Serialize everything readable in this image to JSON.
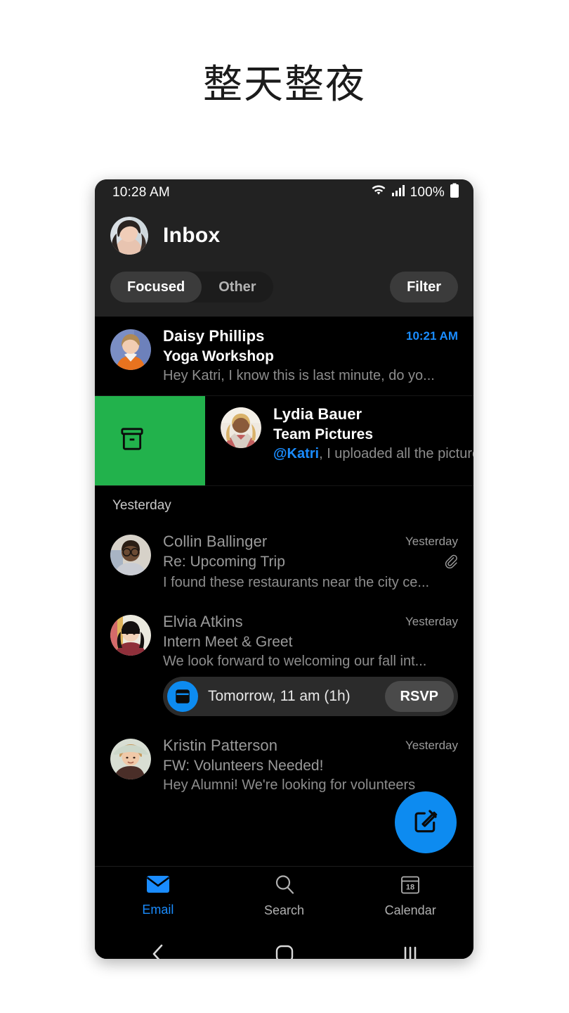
{
  "headline": "整天整夜",
  "statusbar": {
    "time": "10:28 AM",
    "battery_percent": "100%",
    "wifi_icon": "wifi-icon",
    "signal_icon": "signal-bars-icon",
    "battery_icon": "battery-full-icon"
  },
  "header": {
    "title": "Inbox",
    "avatar_icon": "user-avatar",
    "tabs": [
      {
        "label": "Focused",
        "active": true
      },
      {
        "label": "Other",
        "active": false
      }
    ],
    "filter_label": "Filter"
  },
  "swipe": {
    "action_label": "archive",
    "action_icon": "archive-box-icon",
    "action_color": "#22b24c"
  },
  "sections": [
    {
      "label": "Yesterday"
    }
  ],
  "emails": [
    {
      "sender": "Daisy Phillips",
      "subject": "Yoga Workshop",
      "preview": "Hey Katri, I know this is last minute, do yo...",
      "time": "10:21 AM",
      "unread": true,
      "attachment": false,
      "avatar_icon": "avatar-daisy-phillips"
    },
    {
      "sender": "Lydia Bauer",
      "subject": "Team Pictures",
      "preview_mention": "@Katri",
      "preview": ", I uploaded all the pictures",
      "time": "",
      "unread": true,
      "attachment": false,
      "avatar_icon": "avatar-lydia-bauer"
    },
    {
      "sender": "Collin Ballinger",
      "subject": "Re: Upcoming Trip",
      "preview": "I found these restaurants near the city ce...",
      "time": "Yesterday",
      "unread": false,
      "attachment": true,
      "attachment_icon": "paperclip-icon",
      "avatar_icon": "avatar-collin-ballinger"
    },
    {
      "sender": "Elvia Atkins",
      "subject": "Intern Meet & Greet",
      "preview": "We look forward to welcoming our fall int...",
      "time": "Yesterday",
      "unread": false,
      "attachment": false,
      "avatar_icon": "avatar-elvia-atkins"
    },
    {
      "sender": "Kristin Patterson",
      "subject": "FW: Volunteers Needed!",
      "preview": "Hey Alumni! We're looking for volunteers",
      "time": "Yesterday",
      "unread": false,
      "attachment": false,
      "avatar_icon": "avatar-kristin-patterson"
    }
  ],
  "rsvp": {
    "time_text": "Tomorrow, 11 am (1h)",
    "button_label": "RSVP",
    "calendar_icon": "calendar-icon"
  },
  "fab": {
    "label": "compose",
    "icon": "compose-pencil-square-icon"
  },
  "bottomnav": [
    {
      "label": "Email",
      "icon": "envelope-icon",
      "active": true
    },
    {
      "label": "Search",
      "icon": "magnifier-icon",
      "active": false
    },
    {
      "label": "Calendar",
      "icon": "calendar-18-icon",
      "active": false
    }
  ],
  "calendar_day": "18",
  "sysnav": [
    {
      "name": "back-button",
      "icon": "chevron-left-icon"
    },
    {
      "name": "home-button",
      "icon": "rounded-square-icon"
    },
    {
      "name": "recents-button",
      "icon": "three-bars-icon"
    }
  ],
  "colors": {
    "accent_blue": "#1a8cff",
    "fab_blue": "#0d8bf0",
    "archive_green": "#22b24c",
    "header_bg": "#222222",
    "list_bg": "#000000"
  }
}
